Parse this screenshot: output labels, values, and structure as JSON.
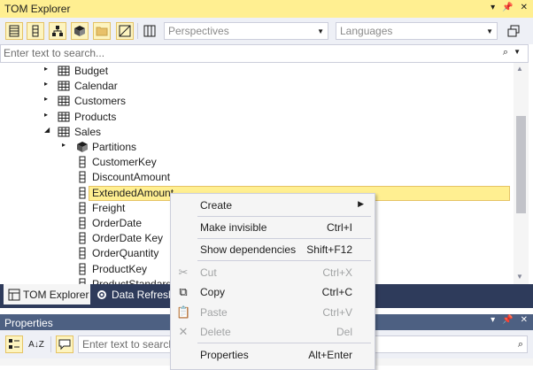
{
  "window": {
    "title": "TOM Explorer"
  },
  "toolbar": {
    "perspectives_placeholder": "Perspectives",
    "languages_placeholder": "Languages"
  },
  "search": {
    "placeholder": "Enter text to search..."
  },
  "tree": {
    "rows": [
      {
        "label": "Budget",
        "icon": "table-icon",
        "expanded": false
      },
      {
        "label": "Calendar",
        "icon": "table-icon",
        "expanded": false
      },
      {
        "label": "Customers",
        "icon": "table-icon",
        "expanded": false
      },
      {
        "label": "Products",
        "icon": "table-icon",
        "expanded": false
      },
      {
        "label": "Sales",
        "icon": "table-icon",
        "expanded": true
      },
      {
        "label": "Partitions",
        "icon": "partitions-icon",
        "expanded": false
      },
      {
        "label": "CustomerKey",
        "icon": "column-icon"
      },
      {
        "label": "DiscountAmount",
        "icon": "column-icon"
      },
      {
        "label": "ExtendedAmount",
        "icon": "column-icon",
        "selected": true
      },
      {
        "label": "Freight",
        "icon": "column-icon"
      },
      {
        "label": "OrderDate",
        "icon": "column-icon"
      },
      {
        "label": "OrderDate Key",
        "icon": "column-icon"
      },
      {
        "label": "OrderQuantity",
        "icon": "column-icon"
      },
      {
        "label": "ProductKey",
        "icon": "column-icon"
      },
      {
        "label": "ProductStandard",
        "icon": "column-icon"
      }
    ]
  },
  "tabs": {
    "tom_explorer": "TOM Explorer",
    "data_refresh": "Data Refresh"
  },
  "properties": {
    "title": "Properties",
    "search_placeholder": "Enter text to search..."
  },
  "context_menu": {
    "items": [
      {
        "label": "Create",
        "shortcut": "",
        "submenu": true,
        "enabled": true
      },
      {
        "label": "Make invisible",
        "shortcut": "Ctrl+I",
        "enabled": true
      },
      {
        "label": "Show dependencies",
        "shortcut": "Shift+F12",
        "enabled": true
      },
      {
        "label": "Cut",
        "shortcut": "Ctrl+X",
        "enabled": false,
        "icon": "cut-icon"
      },
      {
        "label": "Copy",
        "shortcut": "Ctrl+C",
        "enabled": true,
        "icon": "copy-icon"
      },
      {
        "label": "Paste",
        "shortcut": "Ctrl+V",
        "enabled": false,
        "icon": "paste-icon"
      },
      {
        "label": "Delete",
        "shortcut": "Del",
        "enabled": false,
        "icon": "delete-icon"
      },
      {
        "label": "Properties",
        "shortcut": "Alt+Enter",
        "enabled": true
      }
    ]
  },
  "colors": {
    "accent_yellow": "#ffef91",
    "tab_strip": "#2e3b5b",
    "panel_title_inactive": "#4d6082"
  }
}
